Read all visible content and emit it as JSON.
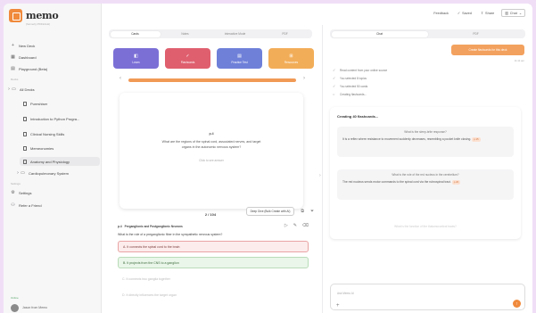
{
  "app": {
    "name": "memo",
    "subtitle": "(formerly PDF2Anki)"
  },
  "sidebar": {
    "new_deck": "New Deck",
    "dashboard": "Dashboard",
    "playground": "Playground (Beta)",
    "decks_caption": "Decks",
    "all_decks": "All Decks",
    "decks": [
      "Pureshiser",
      "Introduction to Python Progra...",
      "Clinical Nursing Skills",
      "Memeonomies",
      "Anatomy and Physiology"
    ],
    "cardio": "Cardiopulmonary System",
    "settings_caption": "Settings",
    "settings": "Settings",
    "refer": "Refer a Friend",
    "online": "Online",
    "user": "Jason from Memo"
  },
  "topbar": {
    "feedback": "Feedback",
    "saved": "Saved",
    "share": "Share",
    "chat": "Chat"
  },
  "center": {
    "tabs": [
      "Cards",
      "Notes",
      "Interactive Mode",
      "PDF"
    ],
    "modes": [
      {
        "label": "Learn",
        "color": "#7b6fd6"
      },
      {
        "label": "Flashcards",
        "color": "#df5f6e"
      },
      {
        "label": "Practice Test",
        "color": "#6f80d9"
      },
      {
        "label": "Resources",
        "color": "#f2ad58"
      }
    ],
    "progress_pct": 100,
    "card": {
      "number": "p.4",
      "question": "What are the regions of the spinal cord, associated nerves, and target organs in the autonomic nervous system?",
      "hint": "Click to see answer"
    },
    "counter": "2 / 104",
    "deep_dive": "Deep Dive (Bulk Create with AI)",
    "quiz": {
      "number": "p.4",
      "section": "Preganglionic and Postganglionic Neurons",
      "question": "What is the role of a preganglionic fiber in the sympathetic nervous system?",
      "options": [
        "A. It connects the spinal cord to the brain",
        "B. It projects from the CNS to a ganglion",
        "C. It connects two ganglia together",
        "D. It directly influences the target organ"
      ]
    }
  },
  "right": {
    "tabs": [
      "Chat",
      "PDF"
    ],
    "action_button": "Create flashcards for this deck",
    "time": "11:11 am",
    "status": [
      "Read content from your online source",
      "You selected 8 topics",
      "You selected 50 cards",
      "Creating flashcards..."
    ],
    "gen_title": "Creating 40 flashcards...",
    "cards": [
      {
        "q": "What is the sleep-brite response?",
        "a": "It is a reflex where resistance to movement suddenly decreases, resembling a pocket knife closing.",
        "tag": "p.15"
      },
      {
        "q": "What is the role of the red nucleus in the cerebellum?",
        "a": "The red nucleus sends motor commands to the spinal cord via the rubrospinal tract.",
        "tag": "p.20"
      }
    ],
    "fade": "What is the function of the thalamocortical tracts?",
    "input_placeholder": "Ask Memo AI"
  }
}
